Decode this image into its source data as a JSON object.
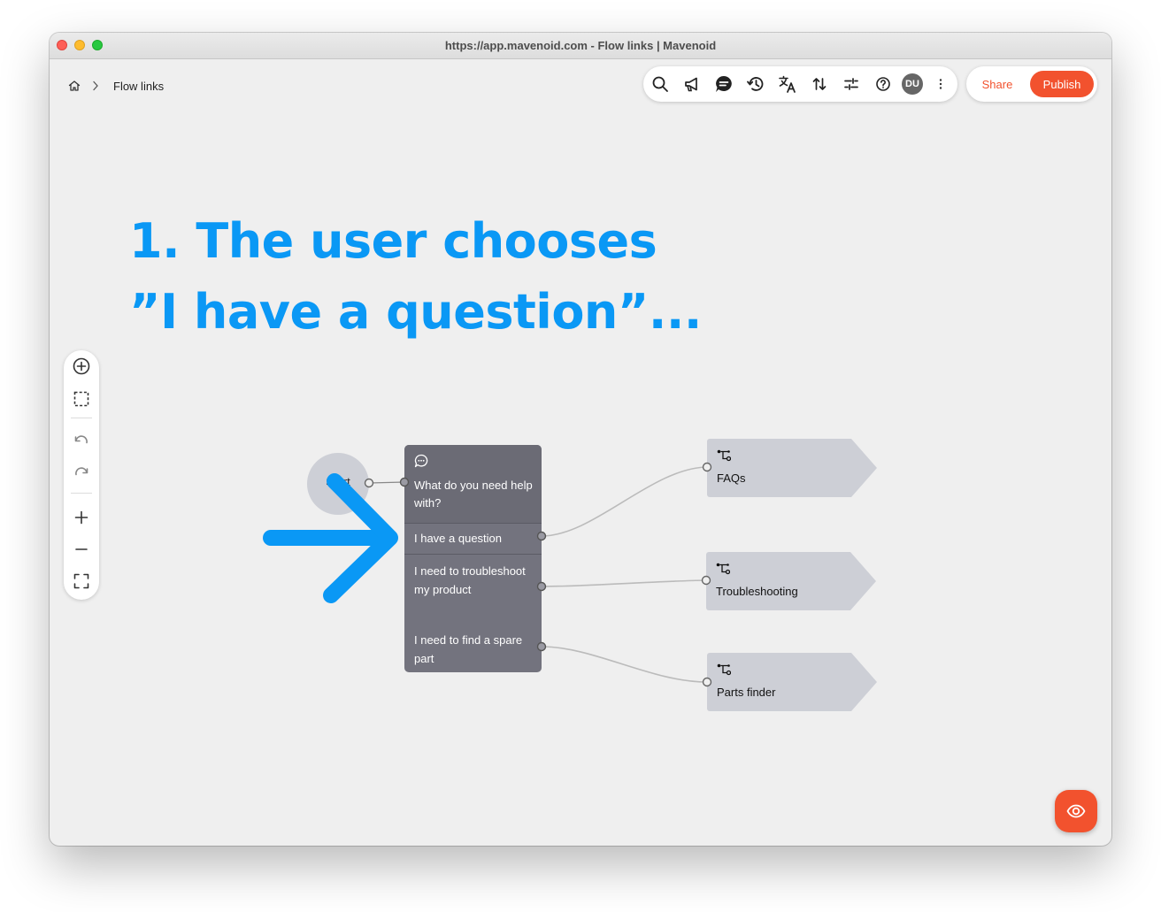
{
  "window": {
    "title": "https://app.mavenoid.com - Flow links | Mavenoid"
  },
  "breadcrumb": {
    "home_icon": "home-icon",
    "separator_icon": "chevron-right-icon",
    "current": "Flow links"
  },
  "toolbar": {
    "icons": [
      "search-icon",
      "megaphone-icon",
      "chat-icon",
      "history-icon",
      "translate-icon",
      "sort-icon",
      "sliders-icon",
      "help-icon"
    ],
    "avatar": "DU",
    "more_icon": "more-vertical-icon",
    "share_label": "Share",
    "publish_label": "Publish"
  },
  "headline": {
    "line1": "1. The user chooses",
    "line2": "”I have a question”..."
  },
  "canvas_tools": [
    "add-node-icon",
    "select-area-icon",
    "undo-icon",
    "redo-icon",
    "zoom-in-icon",
    "zoom-out-icon",
    "fit-view-icon"
  ],
  "flow": {
    "start_label": "Start",
    "question": {
      "icon": "chat-bubble-icon",
      "text": "What do you need help with?",
      "options": [
        "I have a question",
        "I need to troubleshoot my product",
        "I need to find a spare part"
      ]
    },
    "targets": [
      {
        "icon": "flow-link-icon",
        "label": "FAQs"
      },
      {
        "icon": "flow-link-icon",
        "label": "Troubleshooting"
      },
      {
        "icon": "flow-link-icon",
        "label": "Parts finder"
      }
    ]
  },
  "preview": {
    "icon": "eye-icon"
  },
  "colors": {
    "accent": "#f2522e",
    "headline": "#0a98f5",
    "node": "#73737e",
    "target": "#cdcfd6",
    "canvas": "#efefef"
  }
}
